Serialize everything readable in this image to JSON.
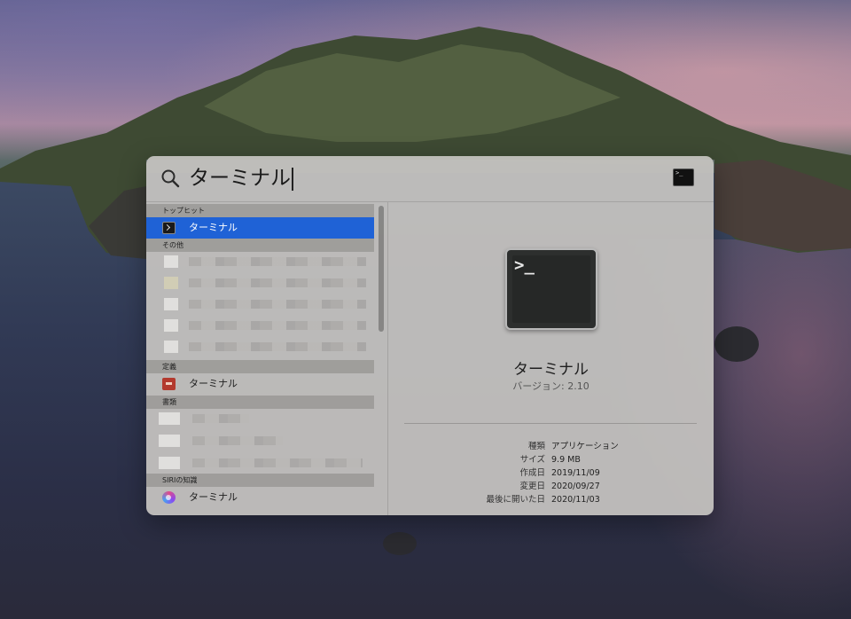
{
  "search": {
    "query": "ターミナル"
  },
  "left_pane": {
    "sections": {
      "top_hit": "トップヒット",
      "other": "その他",
      "definition": "定義",
      "documents": "書類",
      "siri": "SIRIの知識"
    },
    "top_hit_item": "ターミナル",
    "definition_item": "ターミナル",
    "siri_item": "ターミナル"
  },
  "preview": {
    "icon_prompt": ">_",
    "name": "ターミナル",
    "version": "バージョン: 2.10",
    "metadata": [
      {
        "key": "種類",
        "value": "アプリケーション"
      },
      {
        "key": "サイズ",
        "value": "9.9 MB"
      },
      {
        "key": "作成日",
        "value": "2019/11/09"
      },
      {
        "key": "変更日",
        "value": "2020/09/27"
      },
      {
        "key": "最後に開いた日",
        "value": "2020/11/03"
      }
    ]
  },
  "colors": {
    "selection": "#1f62d6"
  }
}
